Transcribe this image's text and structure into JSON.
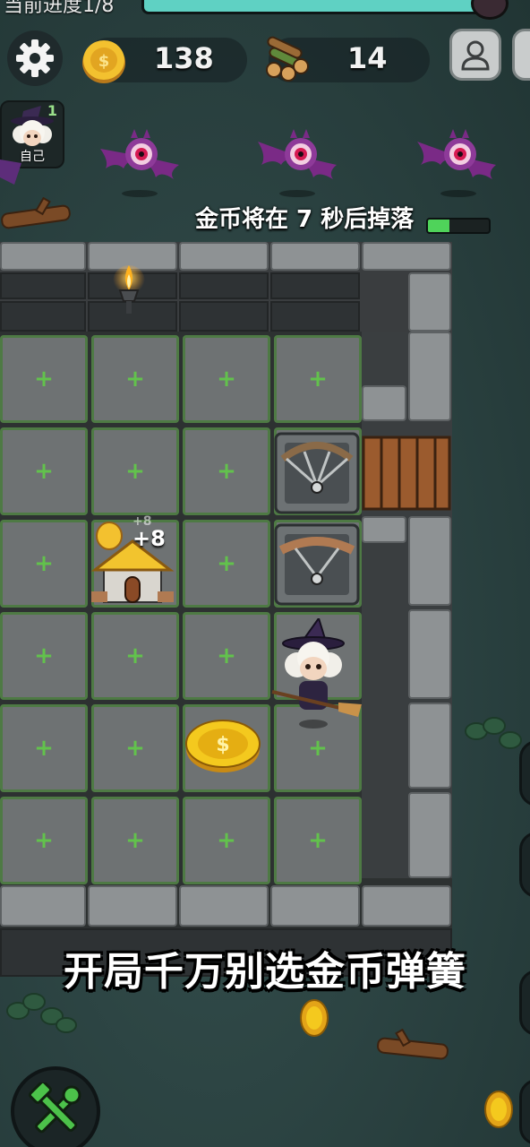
{
  "progress": {
    "label": "当前进度1/8",
    "fraction": 0.95
  },
  "resources": {
    "gold": "138",
    "wood": "14"
  },
  "player": {
    "level": "1",
    "name": "自己"
  },
  "coin_drop": {
    "notice": "金币将在 7 秒后掉落",
    "fraction": 0.35
  },
  "grid_tile_symbol": "+",
  "house_bonus": "+8",
  "house_bonus_faint": "+8",
  "subtitle": "开局千万别选金币弹簧",
  "colors": {
    "progress_fill": "#5fd1c3",
    "drop_fill": "#4fd35a",
    "tile_border": "#4e7a44",
    "plus": "#62c24c"
  },
  "icons": [
    "gear-icon",
    "gold-coin-icon",
    "wood-logs-icon",
    "profile-icon",
    "build-tools-icon"
  ]
}
